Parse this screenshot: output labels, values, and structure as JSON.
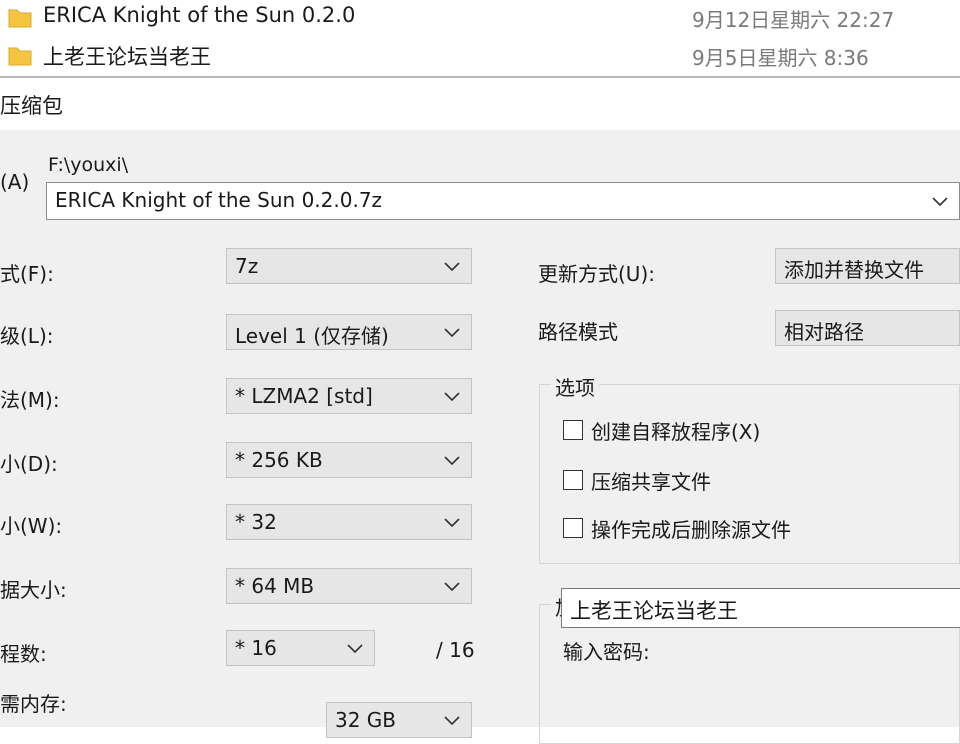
{
  "files": [
    {
      "name": "ERICA Knight of the Sun 0.2.0",
      "date": "9月12日星期六 22:27",
      "icon": "folder-icon"
    },
    {
      "name": "上老王论坛当老王",
      "date": "9月5日星期六 8:36",
      "icon": "folder-icon"
    }
  ],
  "dialog": {
    "title": "压缩包",
    "archive_label": "(A)",
    "archive_path": "F:\\youxi\\",
    "archive_name": "ERICA Knight of the Sun 0.2.0.7z",
    "format_label": "式(F):",
    "format_value": "7z",
    "level_label": "级(L):",
    "level_value": "Level 1 (仅存储)",
    "method_label": "法(M):",
    "method_value": "*  LZMA2 [std]",
    "dict_label": "小(D):",
    "dict_value": "*  256 KB",
    "word_label": "小(W):",
    "word_value": "*  32",
    "solid_label": "据大小:",
    "solid_value": "*  64 MB",
    "threads_label": "程数:",
    "threads_value": "*  16",
    "threads_max": "/ 16",
    "memory_label": "需内存:",
    "memory_value": "32 GB",
    "update_label": "更新方式(U):",
    "update_value": "添加并替换文件",
    "path_label": "路径模式",
    "path_value": "相对路径",
    "options_title": "选项",
    "options": [
      {
        "label": "创建自释放程序(X)",
        "checked": false
      },
      {
        "label": "压缩共享文件",
        "checked": false
      },
      {
        "label": "操作完成后删除源文件",
        "checked": false
      }
    ],
    "encryption_title": "加密",
    "password_label": "输入密码:",
    "password_value": "上老王论坛当老王"
  },
  "colors": {
    "folder": "#f5c542",
    "dialog_bg": "#f0f0f0",
    "combo_bg": "#e6e6e6"
  }
}
